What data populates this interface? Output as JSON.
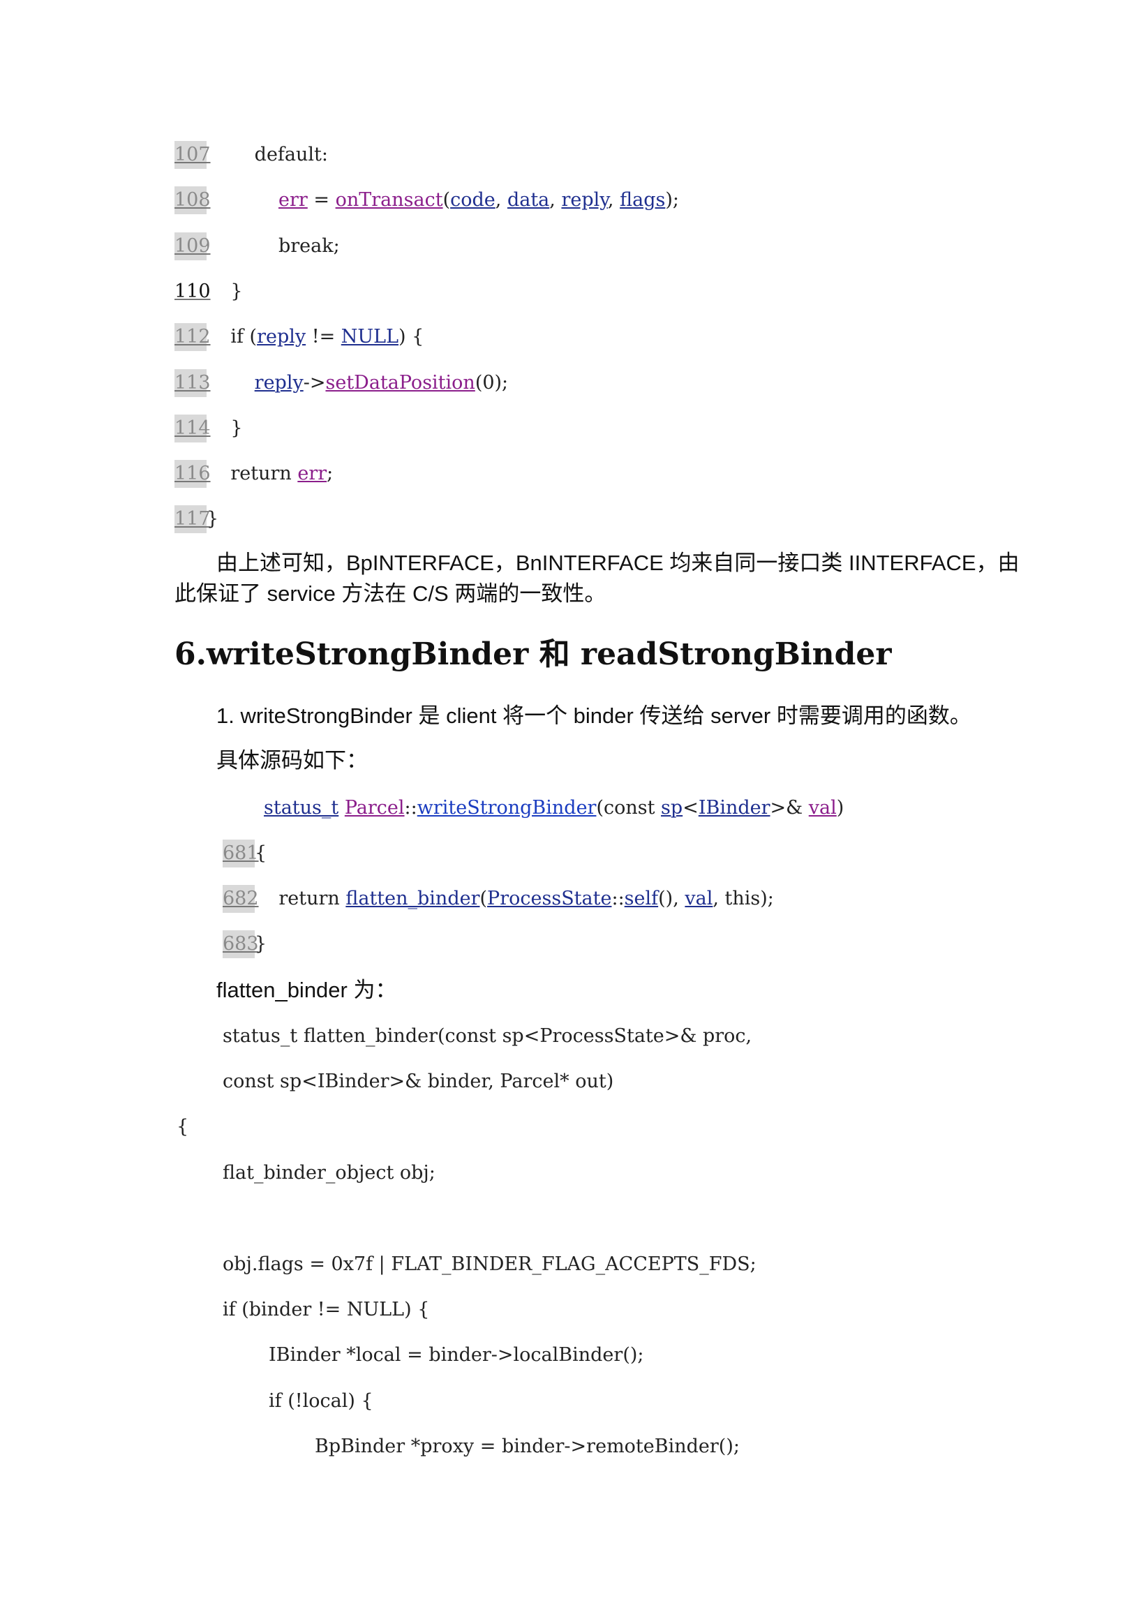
{
  "code_block_1": [
    {
      "ln": "107",
      "parts": [
        {
          "t": "        default:"
        }
      ]
    },
    {
      "ln": "108",
      "parts": [
        {
          "t": "            "
        },
        {
          "t": "err",
          "k": "tk-var"
        },
        {
          "t": " = "
        },
        {
          "t": "onTransact",
          "k": "tk-var"
        },
        {
          "t": "("
        },
        {
          "t": "code",
          "k": "tk-fn"
        },
        {
          "t": ", "
        },
        {
          "t": "data",
          "k": "tk-fn"
        },
        {
          "t": ", "
        },
        {
          "t": "reply",
          "k": "tk-fn"
        },
        {
          "t": ", "
        },
        {
          "t": "flags",
          "k": "tk-fn"
        },
        {
          "t": ");"
        }
      ]
    },
    {
      "ln": "109",
      "parts": [
        {
          "t": "            break;"
        }
      ]
    },
    {
      "ln": "110",
      "dark": true,
      "parts": [
        {
          "t": "    }"
        }
      ]
    },
    {
      "ln": "112",
      "parts": [
        {
          "t": "    if ("
        },
        {
          "t": "reply",
          "k": "tk-fn"
        },
        {
          "t": " != "
        },
        {
          "t": "NULL",
          "k": "tk-fn"
        },
        {
          "t": ") {"
        }
      ]
    },
    {
      "ln": "113",
      "parts": [
        {
          "t": "        "
        },
        {
          "t": "reply",
          "k": "tk-fn"
        },
        {
          "t": "->"
        },
        {
          "t": "setDataPosition",
          "k": "tk-var"
        },
        {
          "t": "(0);"
        }
      ]
    },
    {
      "ln": "114",
      "parts": [
        {
          "t": "    }"
        }
      ]
    },
    {
      "ln": "116",
      "parts": [
        {
          "t": "    return "
        },
        {
          "t": "err",
          "k": "tk-var"
        },
        {
          "t": ";"
        }
      ]
    },
    {
      "ln": "117",
      "parts": [
        {
          "t": "}"
        }
      ]
    }
  ],
  "paragraph_1_line_1": "由上述可知，BpINTERFACE，BnINTERFACE 均来自同一接口类 IINTERFACE，由",
  "paragraph_1_line_2": "此保证了 service 方法在 C/S 两端的一致性。",
  "heading": "6.writeStrongBinder 和 readStrongBinder",
  "item_1": "1. writeStrongBinder 是 client 将一个 binder 传送给 server 时需要调用的函数。",
  "source_intro": "具体源码如下：",
  "signature_parts": [
    {
      "t": "status_t",
      "k": "tk-type"
    },
    {
      "t": " "
    },
    {
      "t": "Parcel",
      "k": "tk-class"
    },
    {
      "t": "::"
    },
    {
      "t": "writeStrongBinder",
      "k": "tk-fnblue"
    },
    {
      "t": "(const "
    },
    {
      "t": "sp",
      "k": "tk-type"
    },
    {
      "t": "<"
    },
    {
      "t": "IBinder",
      "k": "tk-type"
    },
    {
      "t": ">& "
    },
    {
      "t": "val",
      "k": "tk-var"
    },
    {
      "t": ")"
    }
  ],
  "code_block_2": [
    {
      "ln": "681",
      "parts": [
        {
          "t": "{"
        }
      ]
    },
    {
      "ln": "682",
      "parts": [
        {
          "t": "    return "
        },
        {
          "t": "flatten_binder",
          "k": "tk-fn"
        },
        {
          "t": "("
        },
        {
          "t": "ProcessState",
          "k": "tk-fn"
        },
        {
          "t": "::"
        },
        {
          "t": "self",
          "k": "tk-fn"
        },
        {
          "t": "(), "
        },
        {
          "t": "val",
          "k": "tk-fn"
        },
        {
          "t": ", this);"
        }
      ]
    },
    {
      "ln": "683",
      "parts": [
        {
          "t": "}"
        }
      ]
    }
  ],
  "flatten_intro": "flatten_binder 为：",
  "code_block_3": [
    "status_t flatten_binder(const sp<ProcessState>& proc,",
    "const sp<IBinder>& binder, Parcel* out)",
    "{",
    "flat_binder_object obj;",
    "",
    "obj.flags = 0x7f | FLAT_BINDER_FLAG_ACCEPTS_FDS;",
    "if (binder != NULL) {",
    "IBinder *local = binder->localBinder();",
    "if (!local) {",
    "BpBinder *proxy = binder->remoteBinder();"
  ]
}
